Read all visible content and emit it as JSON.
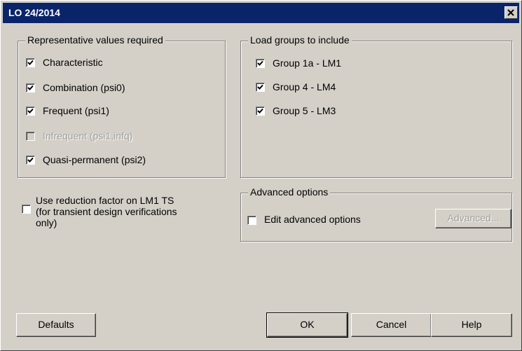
{
  "window": {
    "title": "LO 24/2014"
  },
  "representative": {
    "legend": "Representative values required",
    "items": [
      {
        "label": "Characteristic",
        "checked": true,
        "enabled": true
      },
      {
        "label": "Combination (psi0)",
        "checked": true,
        "enabled": true
      },
      {
        "label": "Frequent (psi1)",
        "checked": true,
        "enabled": true
      },
      {
        "label": "Infrequent (psi1,infq)",
        "checked": false,
        "enabled": false
      },
      {
        "label": "Quasi-permanent (psi2)",
        "checked": true,
        "enabled": true
      }
    ]
  },
  "load_groups": {
    "legend": "Load groups to include",
    "items": [
      {
        "label": "Group 1a - LM1",
        "checked": true
      },
      {
        "label": "Group 4 - LM4",
        "checked": true
      },
      {
        "label": "Group 5 - LM3",
        "checked": true
      }
    ]
  },
  "reduction": {
    "label": "Use reduction factor on LM1 TS (for transient design verifications only)",
    "checked": false
  },
  "advanced": {
    "legend": "Advanced options",
    "edit_label": "Edit advanced options",
    "edit_checked": false,
    "button_label": "Advanced..."
  },
  "buttons": {
    "defaults": "Defaults",
    "ok": "OK",
    "cancel": "Cancel",
    "help": "Help"
  }
}
